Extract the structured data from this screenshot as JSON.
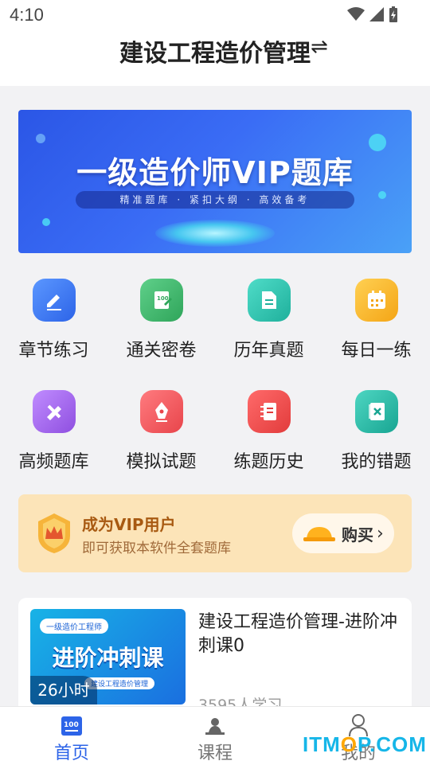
{
  "status": {
    "time": "4:10"
  },
  "header": {
    "title": "建设工程造价管理",
    "swap_icon": "swap-icon"
  },
  "banner": {
    "title": "一级造价师VIP题库",
    "subtitle": "精准题库 · 紧扣大纲 · 高效备考"
  },
  "features": [
    {
      "label": "章节练习",
      "icon": "pencil-icon",
      "color": "#3f7ff0"
    },
    {
      "label": "通关密卷",
      "icon": "exam-paper-icon",
      "color": "#3fb86a"
    },
    {
      "label": "历年真题",
      "icon": "document-icon",
      "color": "#2ec3b1"
    },
    {
      "label": "每日一练",
      "icon": "calendar-icon",
      "color": "#f6b324"
    },
    {
      "label": "高频题库",
      "icon": "tools-icon",
      "color": "#a86de8"
    },
    {
      "label": "模拟试题",
      "icon": "pen-nib-icon",
      "color": "#f2555b"
    },
    {
      "label": "练题历史",
      "icon": "notebook-icon",
      "color": "#f04a4a"
    },
    {
      "label": "我的错题",
      "icon": "wrong-book-icon",
      "color": "#26b8a4"
    }
  ],
  "vip": {
    "title": "成为VIP用户",
    "desc": "即可获取本软件全套题库",
    "buy_label": "购买",
    "chevron": "›"
  },
  "course": {
    "thumb_tag": "一级造价工程师",
    "thumb_title": "进阶冲刺课",
    "thumb_sub": "建设工程造价管理",
    "hours": "26小时",
    "title": "建设工程造价管理-进阶冲刺课0",
    "learners": "3595人学习"
  },
  "tabbar": [
    {
      "label": "首页",
      "icon": "home-100-icon",
      "active": true
    },
    {
      "label": "课程",
      "icon": "teacher-icon",
      "active": false
    },
    {
      "label": "我的",
      "icon": "user-icon",
      "active": false
    }
  ],
  "watermark": {
    "prefix": "ITM",
    "o": "O",
    "suffix": "P.COM"
  },
  "colors": {
    "accent": "#2d64e8",
    "vip_bg": "#fce4b8",
    "vip_text": "#a85a12"
  }
}
